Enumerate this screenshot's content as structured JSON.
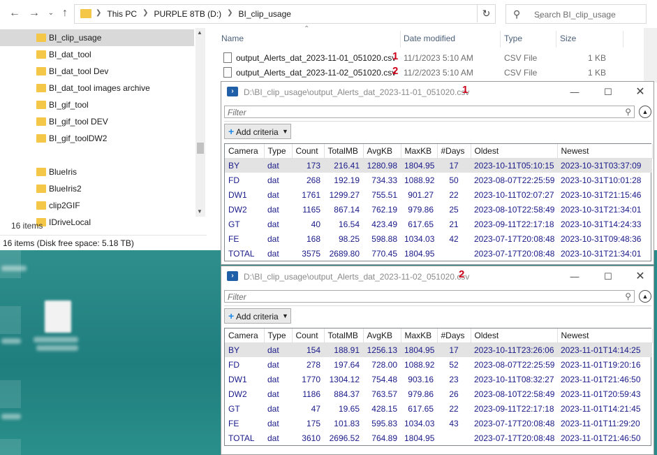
{
  "explorer": {
    "breadcrumbs": [
      "This PC",
      "PURPLE 8TB (D:)",
      "BI_clip_usage"
    ],
    "search_placeholder": "Search BI_clip_usage",
    "nav_items": [
      "BI_clip_usage",
      "BI_dat_tool",
      "BI_dat_tool Dev",
      "BI_dat_tool images archive",
      "BI_gif_tool",
      "BI_gif_tool DEV",
      "BI_gif_toolDW2",
      "BlueIris",
      "BlueIris2",
      "clip2GIF",
      "IDriveLocal"
    ],
    "item_count": "16 items",
    "status": "16 items (Disk free space: 5.18 TB)",
    "columns": {
      "name": "Name",
      "date": "Date modified",
      "type": "Type",
      "size": "Size"
    },
    "files": [
      {
        "name": "output_Alerts_dat_2023-11-01_051020.csv",
        "marker": "1",
        "date": "11/1/2023 5:10 AM",
        "type": "CSV File",
        "size": "1 KB"
      },
      {
        "name": "output_Alerts_dat_2023-11-02_051020.csv",
        "marker": "2",
        "date": "11/2/2023 5:10 AM",
        "type": "CSV File",
        "size": "1 KB"
      }
    ]
  },
  "grid_common": {
    "filter_placeholder": "Filter",
    "add_criteria": "Add criteria",
    "headers": [
      "Camera",
      "Type",
      "Count",
      "TotalMB",
      "AvgKB",
      "MaxKB",
      "#Days",
      "Oldest",
      "Newest"
    ]
  },
  "window1": {
    "title": "D:\\BI_clip_usage\\output_Alerts_dat_2023-11-01_051020.csv",
    "marker": "1",
    "rows": [
      [
        "BY",
        "dat",
        "173",
        "216.41",
        "1280.98",
        "1804.95",
        "17",
        "2023-10-11T05:10:15",
        "2023-10-31T03:37:09"
      ],
      [
        "FD",
        "dat",
        "268",
        "192.19",
        "734.33",
        "1088.92",
        "50",
        "2023-08-07T22:25:59",
        "2023-10-31T10:01:28"
      ],
      [
        "DW1",
        "dat",
        "1761",
        "1299.27",
        "755.51",
        "901.27",
        "22",
        "2023-10-11T02:07:27",
        "2023-10-31T21:15:46"
      ],
      [
        "DW2",
        "dat",
        "1165",
        "867.14",
        "762.19",
        "979.86",
        "25",
        "2023-08-10T22:58:49",
        "2023-10-31T21:34:01"
      ],
      [
        "GT",
        "dat",
        "40",
        "16.54",
        "423.49",
        "617.65",
        "21",
        "2023-09-11T22:17:18",
        "2023-10-31T14:24:33"
      ],
      [
        "FE",
        "dat",
        "168",
        "98.25",
        "598.88",
        "1034.03",
        "42",
        "2023-07-17T20:08:48",
        "2023-10-31T09:48:36"
      ],
      [
        "TOTAL",
        "dat",
        "3575",
        "2689.80",
        "770.45",
        "1804.95",
        "",
        "2023-07-17T20:08:48",
        "2023-10-31T21:34:01"
      ]
    ]
  },
  "window2": {
    "title": "D:\\BI_clip_usage\\output_Alerts_dat_2023-11-02_051020.csv",
    "marker": "2",
    "rows": [
      [
        "BY",
        "dat",
        "154",
        "188.91",
        "1256.13",
        "1804.95",
        "17",
        "2023-10-11T23:26:06",
        "2023-11-01T14:14:25"
      ],
      [
        "FD",
        "dat",
        "278",
        "197.64",
        "728.00",
        "1088.92",
        "52",
        "2023-08-07T22:25:59",
        "2023-11-01T19:20:16"
      ],
      [
        "DW1",
        "dat",
        "1770",
        "1304.12",
        "754.48",
        "903.16",
        "23",
        "2023-10-11T08:32:27",
        "2023-11-01T21:46:50"
      ],
      [
        "DW2",
        "dat",
        "1186",
        "884.37",
        "763.57",
        "979.86",
        "26",
        "2023-08-10T22:58:49",
        "2023-11-01T20:59:43"
      ],
      [
        "GT",
        "dat",
        "47",
        "19.65",
        "428.15",
        "617.65",
        "22",
        "2023-09-11T22:17:18",
        "2023-11-01T14:21:45"
      ],
      [
        "FE",
        "dat",
        "175",
        "101.83",
        "595.83",
        "1034.03",
        "43",
        "2023-07-17T20:08:48",
        "2023-11-01T11:29:20"
      ],
      [
        "TOTAL",
        "dat",
        "3610",
        "2696.52",
        "764.89",
        "1804.95",
        "",
        "2023-07-17T20:08:48",
        "2023-11-01T21:46:50"
      ]
    ]
  }
}
